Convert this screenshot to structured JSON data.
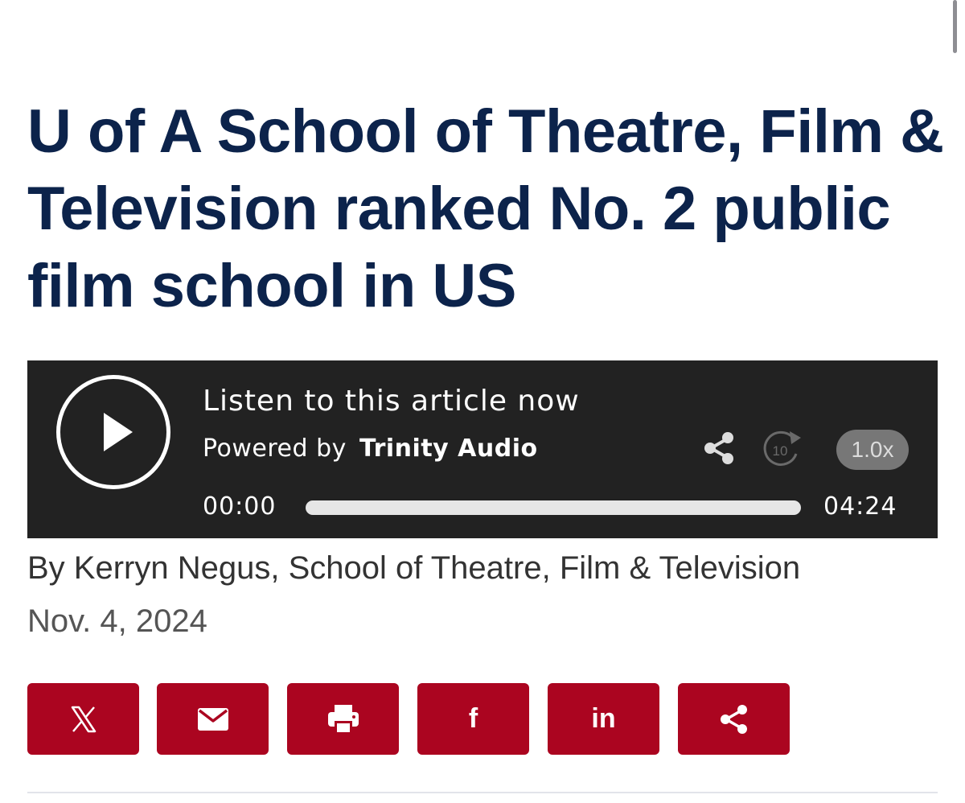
{
  "article": {
    "title": "U of A School of Theatre, Film & Television ranked No. 2 public film school in US",
    "byline": "By Kerryn Negus, School of Theatre, Film & Television",
    "date": "Nov. 4, 2024"
  },
  "audio_player": {
    "listen_label": "Listen to this article now",
    "powered_by_label": "Powered by",
    "brand": "Trinity Audio",
    "rewind_seconds": "10",
    "speed": "1.0x",
    "current_time": "00:00",
    "total_time": "04:24",
    "progress": 0
  },
  "share_buttons": [
    {
      "network": "X",
      "icon": "x-logo-icon"
    },
    {
      "network": "Email",
      "icon": "envelope-icon"
    },
    {
      "network": "Print",
      "icon": "printer-icon"
    },
    {
      "network": "Facebook",
      "icon": "facebook-f-icon",
      "glyph": "f"
    },
    {
      "network": "LinkedIn",
      "icon": "linkedin-icon",
      "glyph": "in"
    },
    {
      "network": "Share",
      "icon": "share-icon"
    }
  ],
  "colors": {
    "headline": "#0c234b",
    "player_bg": "#222222",
    "share_button_bg": "#ab0520"
  }
}
